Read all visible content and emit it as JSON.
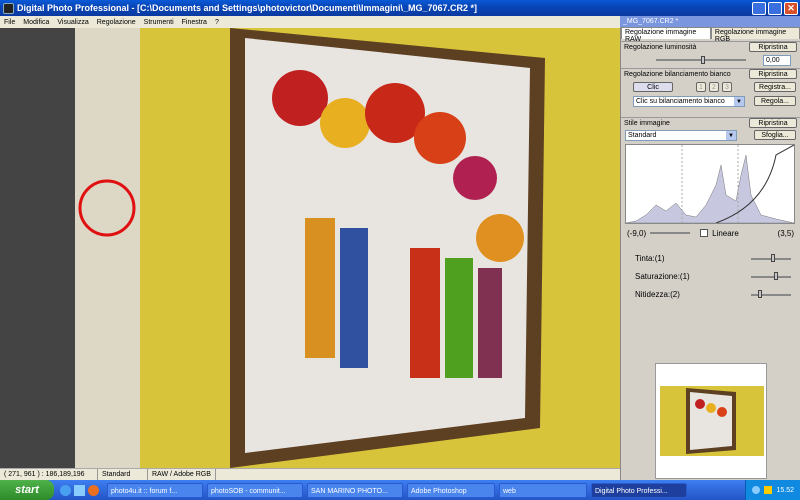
{
  "window": {
    "title": "Digital Photo Professional - [C:\\Documents and Settings\\photovictor\\Documenti\\Immagini\\_MG_7067.CR2 *]"
  },
  "menu": [
    "File",
    "Modifica",
    "Visualizza",
    "Regolazione",
    "Strumenti",
    "Finestra",
    "?"
  ],
  "status": {
    "coords": "( 271, 961 ) : 186,189,196",
    "style": "Standard",
    "format": "RAW / Adobe RGB"
  },
  "panel": {
    "title": "_MG_7067.CR2 *",
    "tabs": [
      "Regolazione immagine RAW",
      "Regolazione immagine RGB"
    ],
    "brightness": {
      "label": "Regolazione luminosità",
      "reset": "Ripristina",
      "value": "0,00"
    },
    "white_balance": {
      "label": "Regolazione bilanciamento bianco",
      "reset": "Ripristina",
      "click": "Clic",
      "presets": [
        "1",
        "2",
        "3"
      ],
      "register": "Registra...",
      "dropdown": "Clic su bilanciamento bianco",
      "adjust": "Regola..."
    },
    "style": {
      "label": "Stile immagine",
      "reset": "Ripristina",
      "dropdown": "Standard",
      "browse": "Sfoglia..."
    },
    "range": {
      "min": "(-9,0)",
      "linear": "Lineare",
      "max": "(3,5)"
    },
    "tint": "Tinta:(1)",
    "saturation": "Saturazione:(1)",
    "sharpness": "Nitidezza:(2)"
  },
  "taskbar": {
    "start": "start",
    "tasks": [
      "photo4u.it :: forum f...",
      "photoSOB - communit...",
      "SAN MARINO PHOTO...",
      "Adobe Photoshop",
      "web",
      "Digital Photo Professi..."
    ],
    "clock": "15.52"
  },
  "colors": {
    "wall_yellow": "#d8c43a",
    "frame_brown": "#6b4a2a",
    "highlight_circle": "#e01010"
  }
}
